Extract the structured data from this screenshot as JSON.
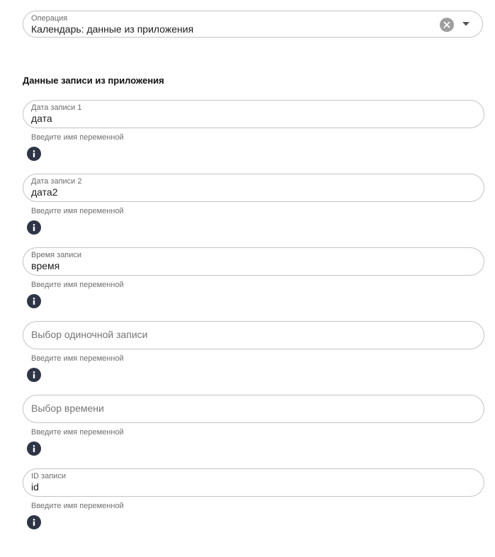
{
  "operation": {
    "label": "Операция",
    "value": "Календарь: данные из приложения",
    "clear_icon": "close-circle-icon",
    "dropdown_icon": "caret-down-icon"
  },
  "section_title": "Данные записи из приложения",
  "fields": [
    {
      "label": "Дата записи 1",
      "value": "дата",
      "placeholder": "",
      "helper": "Введите имя переменной"
    },
    {
      "label": "Дата записи 2",
      "value": "дата2",
      "placeholder": "",
      "helper": "Введите имя переменной"
    },
    {
      "label": "Время записи",
      "value": "время",
      "placeholder": "",
      "helper": "Введите имя переменной"
    },
    {
      "label": "",
      "value": "",
      "placeholder": "Выбор одиночной записи",
      "helper": "Введите имя переменной"
    },
    {
      "label": "",
      "value": "",
      "placeholder": "Выбор времени",
      "helper": "Введите имя переменной"
    },
    {
      "label": "ID записи",
      "value": "id",
      "placeholder": "",
      "helper": "Введите имя переменной"
    }
  ],
  "info_icon": "info-icon",
  "colors": {
    "info_icon_bg": "#2e3547",
    "border": "#c4c4c4",
    "clear_icon_bg": "#9e9e9e"
  }
}
